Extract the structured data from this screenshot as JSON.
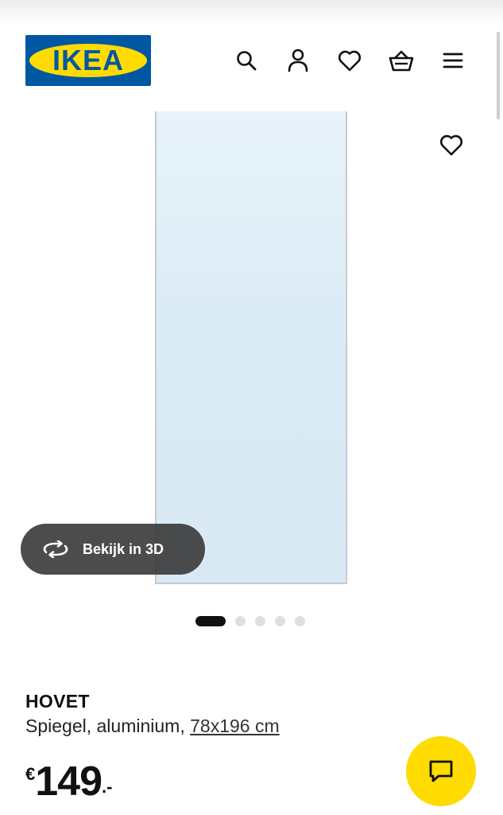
{
  "brand": {
    "logo_text": "IKEA",
    "colors": {
      "blue": "#0058a3",
      "yellow": "#ffdb00"
    }
  },
  "header": {
    "icons": [
      "search-icon",
      "account-icon",
      "favourites-icon",
      "basket-icon",
      "menu-icon"
    ]
  },
  "gallery": {
    "view_3d_label": "Bekijk in 3D",
    "image_count": 5,
    "active_index": 0
  },
  "product": {
    "name": "HOVET",
    "description": "Spiegel, aluminium,",
    "size_link": "78x196 cm",
    "price": {
      "currency": "€",
      "amount": "149",
      "decimals": ".-"
    }
  },
  "chat": {
    "icon": "chat-icon"
  }
}
